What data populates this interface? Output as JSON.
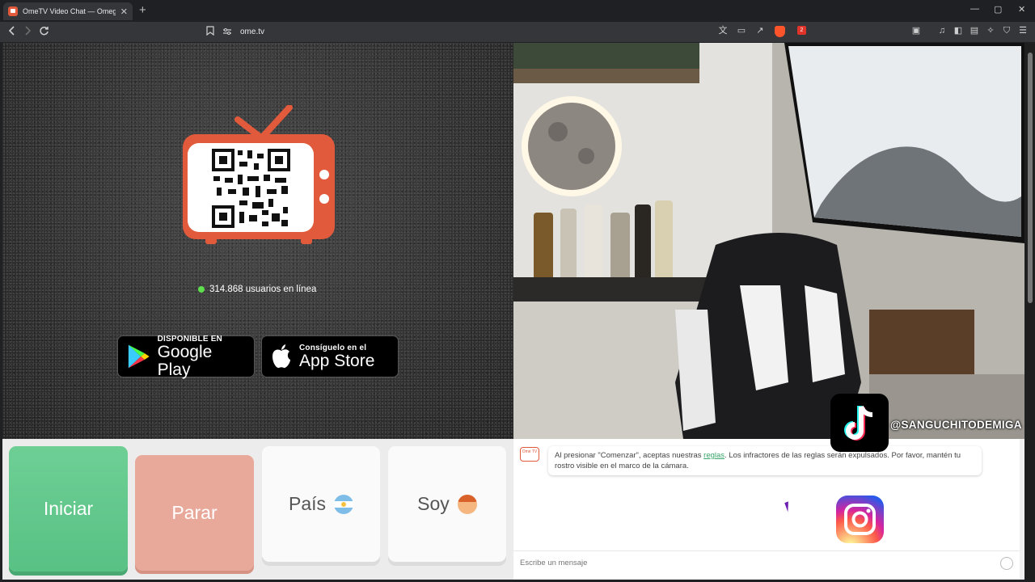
{
  "browser": {
    "tab_title": "OmeTV Video Chat — Omegle",
    "tab_close": "✕",
    "new_tab": "+",
    "url": "ome.tv",
    "brave_count": "2",
    "window_controls": [
      "—",
      "▢",
      "✕"
    ]
  },
  "left_panel": {
    "online_count_text": "314.868 usuarios en línea",
    "google_play": {
      "small": "DISPONIBLE EN",
      "big": "Google Play"
    },
    "app_store": {
      "small": "Consíguelo en el",
      "big": "App Store"
    }
  },
  "buttons": {
    "start": "Iniciar",
    "stop": "Parar",
    "country": "País",
    "gender": "Soy"
  },
  "chat": {
    "logo_text": "Ome TV",
    "message_before_link": "Al presionar \"Comenzar\", aceptas nuestras ",
    "message_link": "reglas",
    "message_after_link": ". Los infractores de las reglas serán expulsados. Por favor, mantén tu rostro visible en el marco de la cámara.",
    "input_placeholder": "Escribe un mensaje"
  },
  "overlay": {
    "tiktok_handle": "@SANGUCHITODEMIGA"
  },
  "colors": {
    "start": "#5fc78a",
    "stop": "#e8a99b",
    "brand": "#e25a3c",
    "online_dot": "#5ee04d",
    "link": "#3aa66b"
  },
  "icons": {
    "nav": [
      "back-icon",
      "forward-icon",
      "reload-icon"
    ],
    "address": [
      "bookmark-icon",
      "site-settings-icon"
    ],
    "toolbar": [
      "translate-icon",
      "cast-icon",
      "share-icon",
      "brave-shield-icon",
      "rewards-icon",
      "screenshot-icon",
      "media-icon",
      "sidebar-icon",
      "wallet-icon",
      "leo-icon",
      "vpn-icon",
      "menu-icon"
    ]
  }
}
